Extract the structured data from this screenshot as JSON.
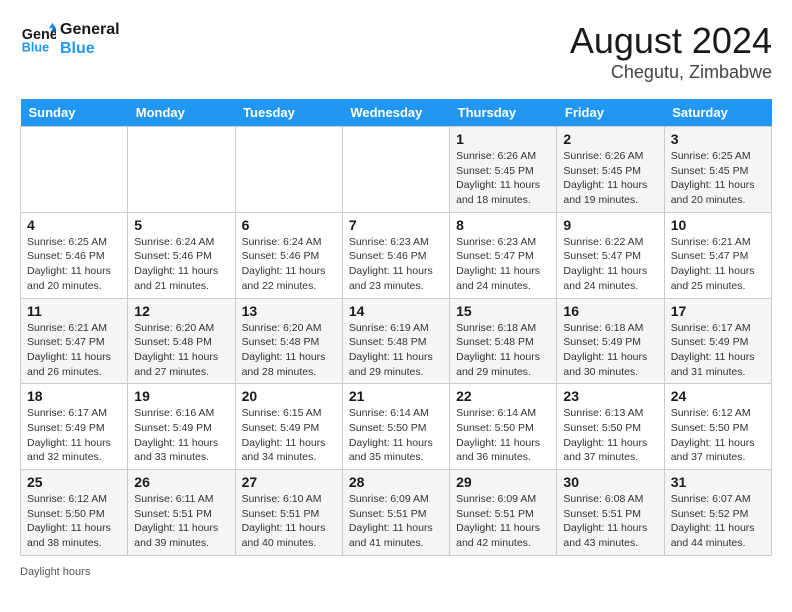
{
  "header": {
    "logo_line1": "General",
    "logo_line2": "Blue",
    "month_year": "August 2024",
    "location": "Chegutu, Zimbabwe"
  },
  "days_of_week": [
    "Sunday",
    "Monday",
    "Tuesday",
    "Wednesday",
    "Thursday",
    "Friday",
    "Saturday"
  ],
  "weeks": [
    [
      {
        "num": "",
        "info": ""
      },
      {
        "num": "",
        "info": ""
      },
      {
        "num": "",
        "info": ""
      },
      {
        "num": "",
        "info": ""
      },
      {
        "num": "1",
        "info": "Sunrise: 6:26 AM\nSunset: 5:45 PM\nDaylight: 11 hours and 18 minutes."
      },
      {
        "num": "2",
        "info": "Sunrise: 6:26 AM\nSunset: 5:45 PM\nDaylight: 11 hours and 19 minutes."
      },
      {
        "num": "3",
        "info": "Sunrise: 6:25 AM\nSunset: 5:45 PM\nDaylight: 11 hours and 20 minutes."
      }
    ],
    [
      {
        "num": "4",
        "info": "Sunrise: 6:25 AM\nSunset: 5:46 PM\nDaylight: 11 hours and 20 minutes."
      },
      {
        "num": "5",
        "info": "Sunrise: 6:24 AM\nSunset: 5:46 PM\nDaylight: 11 hours and 21 minutes."
      },
      {
        "num": "6",
        "info": "Sunrise: 6:24 AM\nSunset: 5:46 PM\nDaylight: 11 hours and 22 minutes."
      },
      {
        "num": "7",
        "info": "Sunrise: 6:23 AM\nSunset: 5:46 PM\nDaylight: 11 hours and 23 minutes."
      },
      {
        "num": "8",
        "info": "Sunrise: 6:23 AM\nSunset: 5:47 PM\nDaylight: 11 hours and 24 minutes."
      },
      {
        "num": "9",
        "info": "Sunrise: 6:22 AM\nSunset: 5:47 PM\nDaylight: 11 hours and 24 minutes."
      },
      {
        "num": "10",
        "info": "Sunrise: 6:21 AM\nSunset: 5:47 PM\nDaylight: 11 hours and 25 minutes."
      }
    ],
    [
      {
        "num": "11",
        "info": "Sunrise: 6:21 AM\nSunset: 5:47 PM\nDaylight: 11 hours and 26 minutes."
      },
      {
        "num": "12",
        "info": "Sunrise: 6:20 AM\nSunset: 5:48 PM\nDaylight: 11 hours and 27 minutes."
      },
      {
        "num": "13",
        "info": "Sunrise: 6:20 AM\nSunset: 5:48 PM\nDaylight: 11 hours and 28 minutes."
      },
      {
        "num": "14",
        "info": "Sunrise: 6:19 AM\nSunset: 5:48 PM\nDaylight: 11 hours and 29 minutes."
      },
      {
        "num": "15",
        "info": "Sunrise: 6:18 AM\nSunset: 5:48 PM\nDaylight: 11 hours and 29 minutes."
      },
      {
        "num": "16",
        "info": "Sunrise: 6:18 AM\nSunset: 5:49 PM\nDaylight: 11 hours and 30 minutes."
      },
      {
        "num": "17",
        "info": "Sunrise: 6:17 AM\nSunset: 5:49 PM\nDaylight: 11 hours and 31 minutes."
      }
    ],
    [
      {
        "num": "18",
        "info": "Sunrise: 6:17 AM\nSunset: 5:49 PM\nDaylight: 11 hours and 32 minutes."
      },
      {
        "num": "19",
        "info": "Sunrise: 6:16 AM\nSunset: 5:49 PM\nDaylight: 11 hours and 33 minutes."
      },
      {
        "num": "20",
        "info": "Sunrise: 6:15 AM\nSunset: 5:49 PM\nDaylight: 11 hours and 34 minutes."
      },
      {
        "num": "21",
        "info": "Sunrise: 6:14 AM\nSunset: 5:50 PM\nDaylight: 11 hours and 35 minutes."
      },
      {
        "num": "22",
        "info": "Sunrise: 6:14 AM\nSunset: 5:50 PM\nDaylight: 11 hours and 36 minutes."
      },
      {
        "num": "23",
        "info": "Sunrise: 6:13 AM\nSunset: 5:50 PM\nDaylight: 11 hours and 37 minutes."
      },
      {
        "num": "24",
        "info": "Sunrise: 6:12 AM\nSunset: 5:50 PM\nDaylight: 11 hours and 37 minutes."
      }
    ],
    [
      {
        "num": "25",
        "info": "Sunrise: 6:12 AM\nSunset: 5:50 PM\nDaylight: 11 hours and 38 minutes."
      },
      {
        "num": "26",
        "info": "Sunrise: 6:11 AM\nSunset: 5:51 PM\nDaylight: 11 hours and 39 minutes."
      },
      {
        "num": "27",
        "info": "Sunrise: 6:10 AM\nSunset: 5:51 PM\nDaylight: 11 hours and 40 minutes."
      },
      {
        "num": "28",
        "info": "Sunrise: 6:09 AM\nSunset: 5:51 PM\nDaylight: 11 hours and 41 minutes."
      },
      {
        "num": "29",
        "info": "Sunrise: 6:09 AM\nSunset: 5:51 PM\nDaylight: 11 hours and 42 minutes."
      },
      {
        "num": "30",
        "info": "Sunrise: 6:08 AM\nSunset: 5:51 PM\nDaylight: 11 hours and 43 minutes."
      },
      {
        "num": "31",
        "info": "Sunrise: 6:07 AM\nSunset: 5:52 PM\nDaylight: 11 hours and 44 minutes."
      }
    ]
  ],
  "footer": {
    "daylight_label": "Daylight hours"
  }
}
